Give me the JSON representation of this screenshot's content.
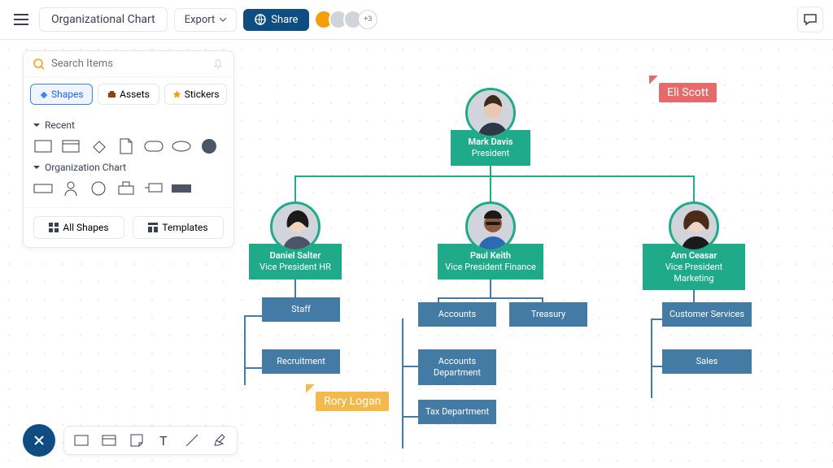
{
  "header": {
    "title": "Organizational Chart",
    "export_label": "Export",
    "share_label": "Share",
    "avatar_more": "+3"
  },
  "sidebar": {
    "search_placeholder": "Search Items",
    "tabs": {
      "shapes": "Shapes",
      "assets": "Assets",
      "stickers": "Stickers"
    },
    "sections": {
      "recent": "Recent",
      "org": "Organization Chart"
    },
    "buttons": {
      "all_shapes": "All Shapes",
      "templates": "Templates"
    }
  },
  "cursors": {
    "eli": "Eli Scott",
    "rory": "Rory Logan"
  },
  "org": {
    "president": {
      "name": "Mark Davis",
      "title": "President"
    },
    "vp_hr": {
      "name": "Daniel Salter",
      "title": "Vice President HR"
    },
    "vp_finance": {
      "name": "Paul Keith",
      "title": "Vice President Finance"
    },
    "vp_marketing": {
      "name": "Ann Ceasar",
      "title": "Vice President Marketing"
    },
    "hr_children": {
      "staff": "Staff",
      "recruitment": "Recruitment"
    },
    "fin_children": {
      "accounts": "Accounts",
      "treasury": "Treasury",
      "accounts_dept": "Accounts Department",
      "tax": "Tax Department"
    },
    "mkt_children": {
      "customer": "Customer Services",
      "sales": "Sales"
    }
  }
}
